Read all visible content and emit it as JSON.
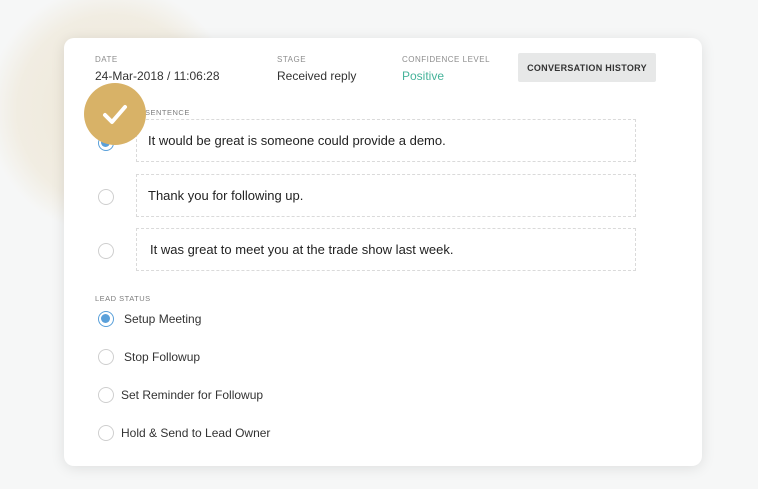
{
  "meta": {
    "date_label": "DATE",
    "date_value": "24-Mar-2018 / 11:06:28",
    "stage_label": "STAGE",
    "stage_value": "Received reply",
    "confidence_label": "CONFIDENCE LEVEL",
    "confidence_value": "Positive",
    "history_button": "CONVERSATION HISTORY"
  },
  "sentence_section": {
    "label": "SENTENCE",
    "selected_index": 0,
    "options": [
      "It would be great is someone could provide a demo.",
      "Thank you for following up.",
      "It was great to meet you at the trade show last week."
    ]
  },
  "lead_status": {
    "label": "LEAD STATUS",
    "selected_index": 0,
    "options": [
      "Setup Meeting",
      "Stop Followup",
      "Set Reminder for Followup",
      "Hold & Send to Lead Owner"
    ]
  },
  "overlay": {
    "icon": "checkmark-icon",
    "color": "#d8b267"
  },
  "colors": {
    "accent": "#5aa0da",
    "positive": "#46b39a"
  }
}
